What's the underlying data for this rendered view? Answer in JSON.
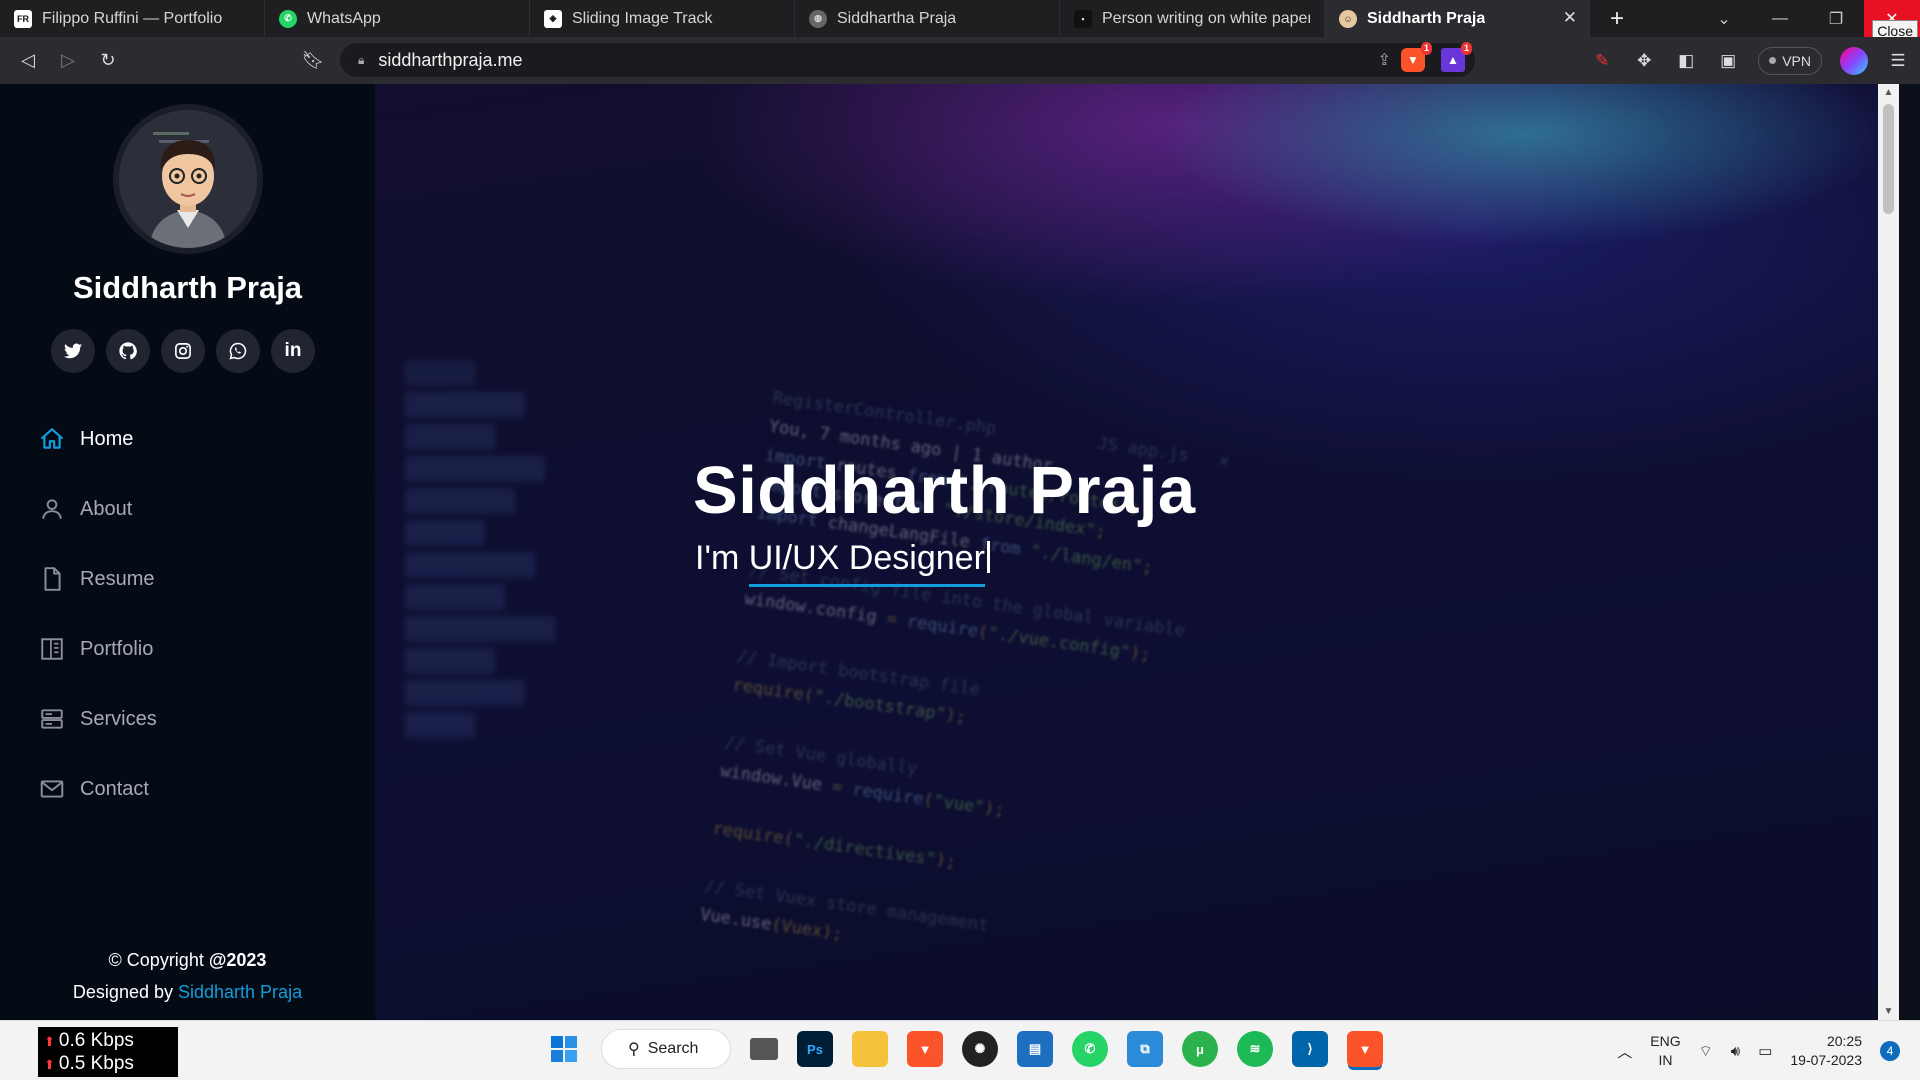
{
  "browser": {
    "tabs": [
      {
        "title": "Filippo Ruffini — Portfolio",
        "favicon_text": "FR",
        "favicon_color": "#ffffff",
        "active": false
      },
      {
        "title": "WhatsApp",
        "favicon_text": "",
        "favicon_color": "#25d366",
        "active": false
      },
      {
        "title": "Sliding Image Track",
        "favicon_text": "",
        "favicon_color": "#ffffff",
        "active": false
      },
      {
        "title": "Siddhartha Praja",
        "favicon_text": "",
        "favicon_color": "#bbbbbb",
        "active": false
      },
      {
        "title": "Person writing on white paper pl",
        "favicon_text": "",
        "favicon_color": "#222222",
        "active": false
      },
      {
        "title": "Siddharth Praja",
        "favicon_text": "",
        "favicon_color": "#e8c8a0",
        "active": true
      }
    ],
    "close_tooltip": "Close",
    "url": "siddharthpraja.me",
    "vpn_label": "VPN",
    "shield_badge": "1",
    "rewards_badge": "1"
  },
  "sidebar": {
    "name": "Siddharth Praja",
    "socials": [
      {
        "icon": "twitter-icon",
        "glyph": "🐦"
      },
      {
        "icon": "github-icon",
        "glyph": "⌥"
      },
      {
        "icon": "instagram-icon",
        "glyph": "◎"
      },
      {
        "icon": "whatsapp-icon",
        "glyph": "✆"
      },
      {
        "icon": "linkedin-icon",
        "glyph": "in"
      }
    ],
    "nav": [
      {
        "label": "Home",
        "icon": "home-icon",
        "active": true
      },
      {
        "label": "About",
        "icon": "user-icon",
        "active": false
      },
      {
        "label": "Resume",
        "icon": "file-icon",
        "active": false
      },
      {
        "label": "Portfolio",
        "icon": "book-icon",
        "active": false
      },
      {
        "label": "Services",
        "icon": "server-icon",
        "active": false
      },
      {
        "label": "Contact",
        "icon": "envelope-icon",
        "active": false
      }
    ],
    "footer": {
      "copyright_prefix": "© Copyright ",
      "copyright_year": "@2023",
      "designed_by": "Designed by ",
      "designer": "Siddharth Praja"
    },
    "accent": "#149ddd"
  },
  "hero": {
    "title": "Siddharth Praja",
    "prefix": "I'm ",
    "role": "UI/UX Designer"
  },
  "taskbar": {
    "net_up": "0.6 Kbps",
    "net_down": "0.5 Kbps",
    "search_label": "Search",
    "lang_line1": "ENG",
    "lang_line2": "IN",
    "time": "20:25",
    "date": "19-07-2023",
    "notification_count": "4"
  }
}
